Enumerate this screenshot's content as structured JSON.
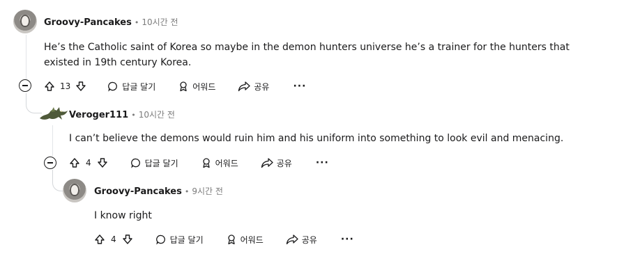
{
  "comments": [
    {
      "author": "Groovy-Pancakes",
      "separator": "•",
      "time": "10시간 전",
      "body": "He’s the Catholic saint of Korea so maybe in the demon hunters universe he’s a trainer for the hunters that existed in 19th century Korea.",
      "votes": "13",
      "reply_label": "답글 달기",
      "award_label": "어워드",
      "share_label": "공유",
      "more_label": "···"
    },
    {
      "author": "Veroger111",
      "separator": "•",
      "time": "10시간 전",
      "body": "I can’t believe the demons would ruin him and his uniform into something to look evil and menacing.",
      "votes": "4",
      "reply_label": "답글 달기",
      "award_label": "어워드",
      "share_label": "공유",
      "more_label": "···"
    },
    {
      "author": "Groovy-Pancakes",
      "separator": "•",
      "time": "9시간 전",
      "body": "I know right",
      "votes": "4",
      "reply_label": "답글 달기",
      "award_label": "어워드",
      "share_label": "공유",
      "more_label": "···"
    }
  ],
  "icons": [
    "avatar",
    "dragon-avatar",
    "collapse-icon",
    "upvote-icon",
    "downvote-icon",
    "comment-icon",
    "award-icon",
    "share-icon",
    "more-icon"
  ]
}
